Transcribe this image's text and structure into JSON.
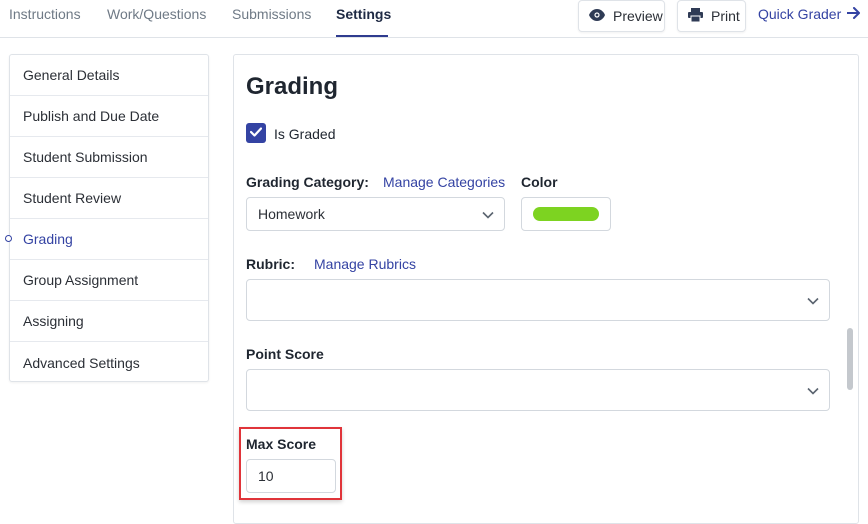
{
  "nav": {
    "tabs": [
      "Instructions",
      "Work/Questions",
      "Submissions",
      "Settings"
    ],
    "active_tab": "Settings",
    "preview_label": "Preview",
    "print_label": "Print",
    "quick_grader_label": "Quick Grader"
  },
  "sidebar": {
    "items": [
      {
        "label": "General Details"
      },
      {
        "label": "Publish and Due Date"
      },
      {
        "label": "Student Submission"
      },
      {
        "label": "Student Review"
      },
      {
        "label": "Grading"
      },
      {
        "label": "Group Assignment"
      },
      {
        "label": "Assigning"
      },
      {
        "label": "Advanced Settings"
      }
    ],
    "active_item": "Grading"
  },
  "grading": {
    "title": "Grading",
    "is_graded_label": "Is Graded",
    "is_graded": true,
    "category_label": "Grading Category:",
    "manage_categories_link": "Manage Categories",
    "category_value": "Homework",
    "color_label": "Color",
    "color_value": "#7dd321",
    "rubric_label": "Rubric:",
    "manage_rubrics_link": "Manage Rubrics",
    "rubric_value": "",
    "point_score_label": "Point Score",
    "point_score_value": "",
    "max_score_label": "Max Score",
    "max_score_value": "10"
  },
  "colors": {
    "accent": "#3443a3",
    "highlight": "#e0343a"
  },
  "icons": {
    "preview": "eye-icon",
    "print": "printer-icon",
    "quick_grader": "arrow-right-icon",
    "checkbox": "check-icon",
    "dropdown": "chevron-down-icon"
  }
}
